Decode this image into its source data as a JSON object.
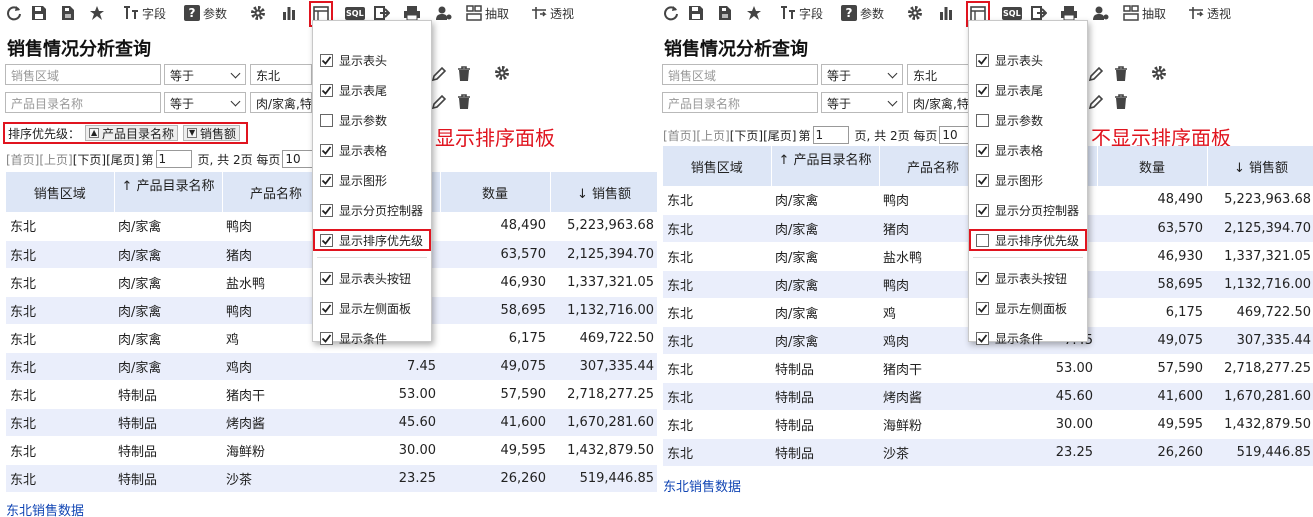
{
  "toolbar": {
    "fields": "字段",
    "params": "参数",
    "sql": "SQL",
    "extract": "抽取",
    "pivot": "透视"
  },
  "page": {
    "title": "销售情况分析查询",
    "footer_link": "东北销售数据"
  },
  "filters": {
    "row1": {
      "field_placeholder": "销售区域",
      "operator": "等于",
      "value": "东北"
    },
    "row2": {
      "field_placeholder": "产品目录名称",
      "operator": "等于",
      "value": "肉/家禽,特"
    }
  },
  "sort_panel": {
    "label": "排序优先级：",
    "items": [
      "产品目录名称",
      "销售额"
    ]
  },
  "annotations": {
    "left": "显示排序面板",
    "right": "不显示排序面板"
  },
  "pager": {
    "first": "[首页]",
    "prev": "[上页]",
    "next": "[下页]",
    "last": "[尾页]",
    "page_label": "第",
    "page_value": "1",
    "page_suffix": "页, 共 2页 每页",
    "page_size": "10"
  },
  "table": {
    "columns": [
      "销售区域",
      "产品目录名称",
      "产品名称",
      "",
      "数量",
      "销售额"
    ],
    "column_sort": [
      "",
      "asc",
      "",
      "",
      "",
      "desc"
    ],
    "rows": [
      [
        "东北",
        "肉/家禽",
        "鸭肉",
        "",
        "48,490",
        "5,223,963.68"
      ],
      [
        "东北",
        "肉/家禽",
        "猪肉",
        "",
        "63,570",
        "2,125,394.70"
      ],
      [
        "东北",
        "肉/家禽",
        "盐水鸭",
        "",
        "46,930",
        "1,337,321.05"
      ],
      [
        "东北",
        "肉/家禽",
        "鸭肉",
        "",
        "58,695",
        "1,132,716.00"
      ],
      [
        "东北",
        "肉/家禽",
        "鸡",
        "",
        "6,175",
        "469,722.50"
      ],
      [
        "东北",
        "肉/家禽",
        "鸡肉",
        "7.45",
        "49,075",
        "307,335.44"
      ],
      [
        "东北",
        "特制品",
        "猪肉干",
        "53.00",
        "57,590",
        "2,718,277.25"
      ],
      [
        "东北",
        "特制品",
        "烤肉酱",
        "45.60",
        "41,600",
        "1,670,281.60"
      ],
      [
        "东北",
        "特制品",
        "海鲜粉",
        "30.00",
        "49,595",
        "1,432,879.50"
      ],
      [
        "东北",
        "特制品",
        "沙茶",
        "23.25",
        "26,260",
        "519,446.85"
      ]
    ]
  },
  "menu_items": [
    "显示表头",
    "显示表尾",
    "显示参数",
    "显示表格",
    "显示图形",
    "显示分页控制器",
    "显示排序优先级",
    "显示表头按钮",
    "显示左侧面板",
    "显示条件"
  ],
  "menu_state_left": [
    true,
    true,
    false,
    true,
    true,
    true,
    true,
    true,
    true,
    true
  ],
  "menu_state_right": [
    true,
    true,
    false,
    true,
    true,
    true,
    false,
    true,
    true,
    true
  ],
  "icons": [
    "refresh-icon",
    "save-icon",
    "save-as-icon",
    "star-icon",
    "field-icon",
    "question-icon",
    "gear-icon",
    "bar-chart-icon",
    "layout-icon",
    "sql-icon",
    "export-icon",
    "print-icon",
    "user-settings-icon",
    "extract-icon",
    "pivot-icon",
    "pencil-icon",
    "trash-icon"
  ],
  "colors": {
    "accent_red": "#e0141f",
    "header_bg": "#dde6f6",
    "row_alt_bg": "#eaeefb",
    "link": "#1246b4"
  }
}
